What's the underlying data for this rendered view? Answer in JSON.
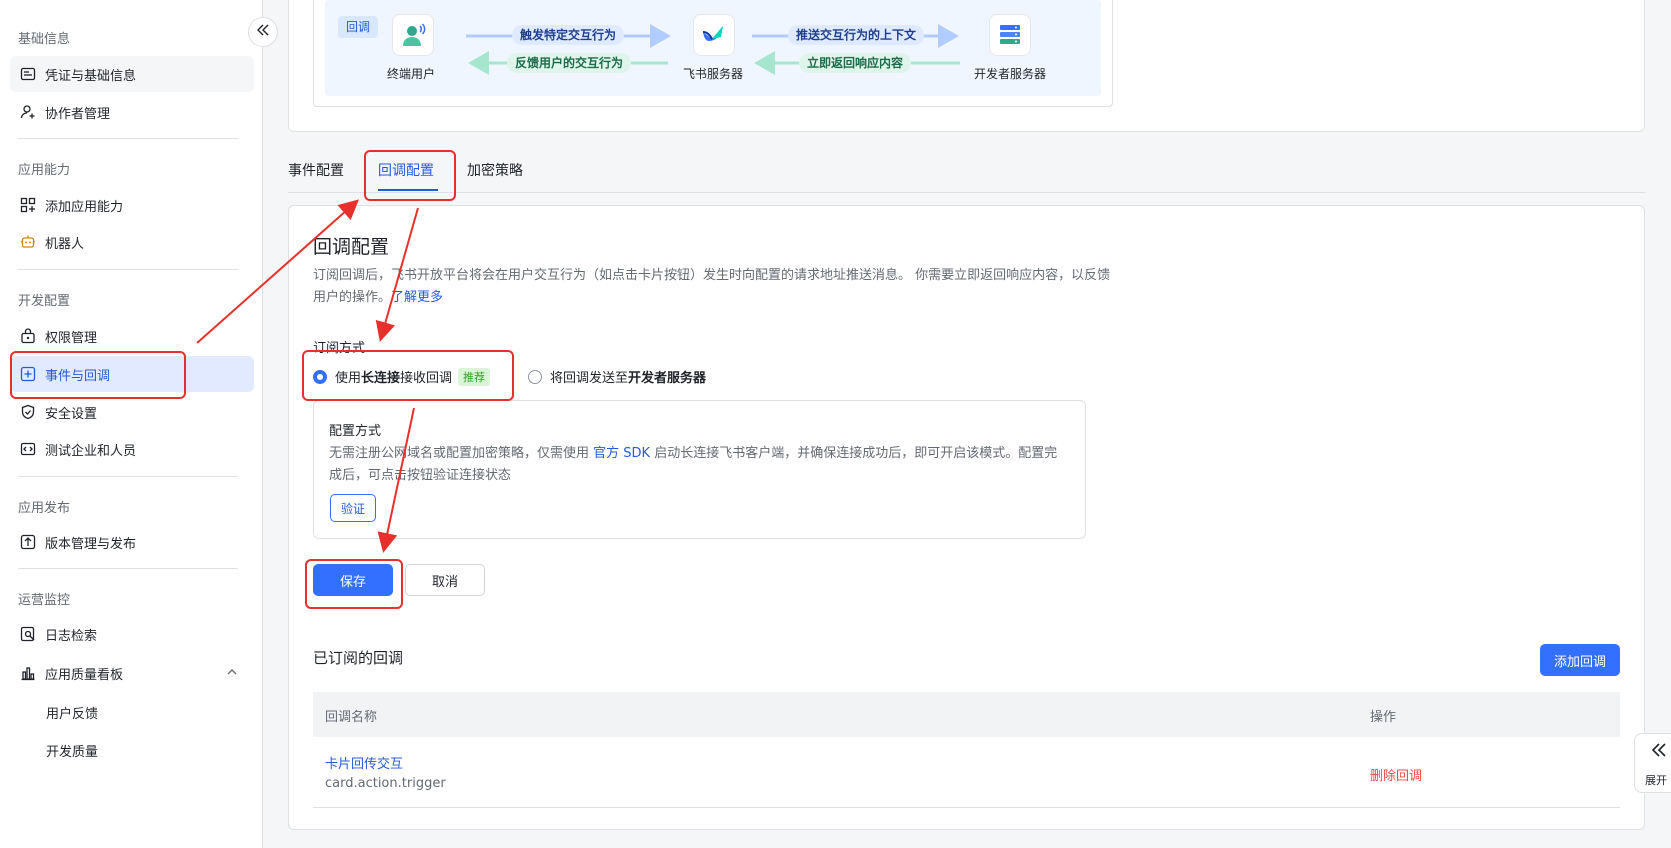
{
  "sidebar": {
    "groups": [
      {
        "title": "基础信息",
        "items": [
          {
            "label": "凭证与基础信息",
            "icon": "credential-icon"
          },
          {
            "label": "协作者管理",
            "icon": "user-add-icon"
          }
        ]
      },
      {
        "title": "应用能力",
        "items": [
          {
            "label": "添加应用能力",
            "icon": "apps-icon"
          },
          {
            "label": "机器人",
            "icon": "robot-icon"
          }
        ]
      },
      {
        "title": "开发配置",
        "items": [
          {
            "label": "权限管理",
            "icon": "lock-icon"
          },
          {
            "label": "事件与回调",
            "icon": "event-icon"
          },
          {
            "label": "安全设置",
            "icon": "shield-icon"
          },
          {
            "label": "测试企业和人员",
            "icon": "code-icon"
          }
        ]
      },
      {
        "title": "应用发布",
        "items": [
          {
            "label": "版本管理与发布",
            "icon": "upload-icon"
          }
        ]
      },
      {
        "title": "运营监控",
        "items": [
          {
            "label": "日志检索",
            "icon": "log-search-icon"
          },
          {
            "label": "应用质量看板",
            "icon": "bar-chart-icon"
          },
          {
            "label": "用户反馈"
          },
          {
            "label": "开发质量"
          }
        ]
      }
    ]
  },
  "flow": {
    "tag": "回调",
    "nodes": [
      "终端用户",
      "飞书服务器",
      "开发者服务器"
    ],
    "chips": {
      "trigger": "触发特定交互行为",
      "feedback": "反馈用户的交互行为",
      "push": "推送交互行为的上下文",
      "respond": "立即返回响应内容"
    }
  },
  "tabs": [
    "事件配置",
    "回调配置",
    "加密策略"
  ],
  "section": {
    "title": "回调配置",
    "desc_part1": "订阅回调后，飞书开放平台将会在用户交互行为（如点击卡片按钮）发生时向配置的请求地址推送消息。 你需要立即返回响应内容，以反馈用户的操作。",
    "learn_more": "了解更多",
    "sub_mode_label": "订阅方式",
    "option1_a": "使用 ",
    "option1_bold": "长连接",
    "option1_b": " 接收回调",
    "option1_badge": "推荐",
    "option2_a": "将回调发送至 ",
    "option2_bold": "开发者服务器",
    "config_title": "配置方式",
    "config_desc_a": "无需注册公网域名或配置加密策略，仅需使用 ",
    "config_desc_link": "官方 SDK",
    "config_desc_b": " 启动长连接飞书客户端，并确保连接成功后，即可开启该模式。配置完成后，可点击按钮验证连接状态",
    "verify": "验证",
    "save": "保存",
    "cancel": "取消"
  },
  "subscribed": {
    "title": "已订阅的回调",
    "add_button": "添加回调",
    "columns": [
      "回调名称",
      "操作"
    ],
    "rows": [
      {
        "name": "卡片回传交互",
        "id": "card.action.trigger",
        "action": "删除回调"
      }
    ]
  },
  "expand_label": "展开",
  "colors": {
    "accent": "#3370ff",
    "annotation": "#e7302b",
    "danger": "#f54a45"
  }
}
